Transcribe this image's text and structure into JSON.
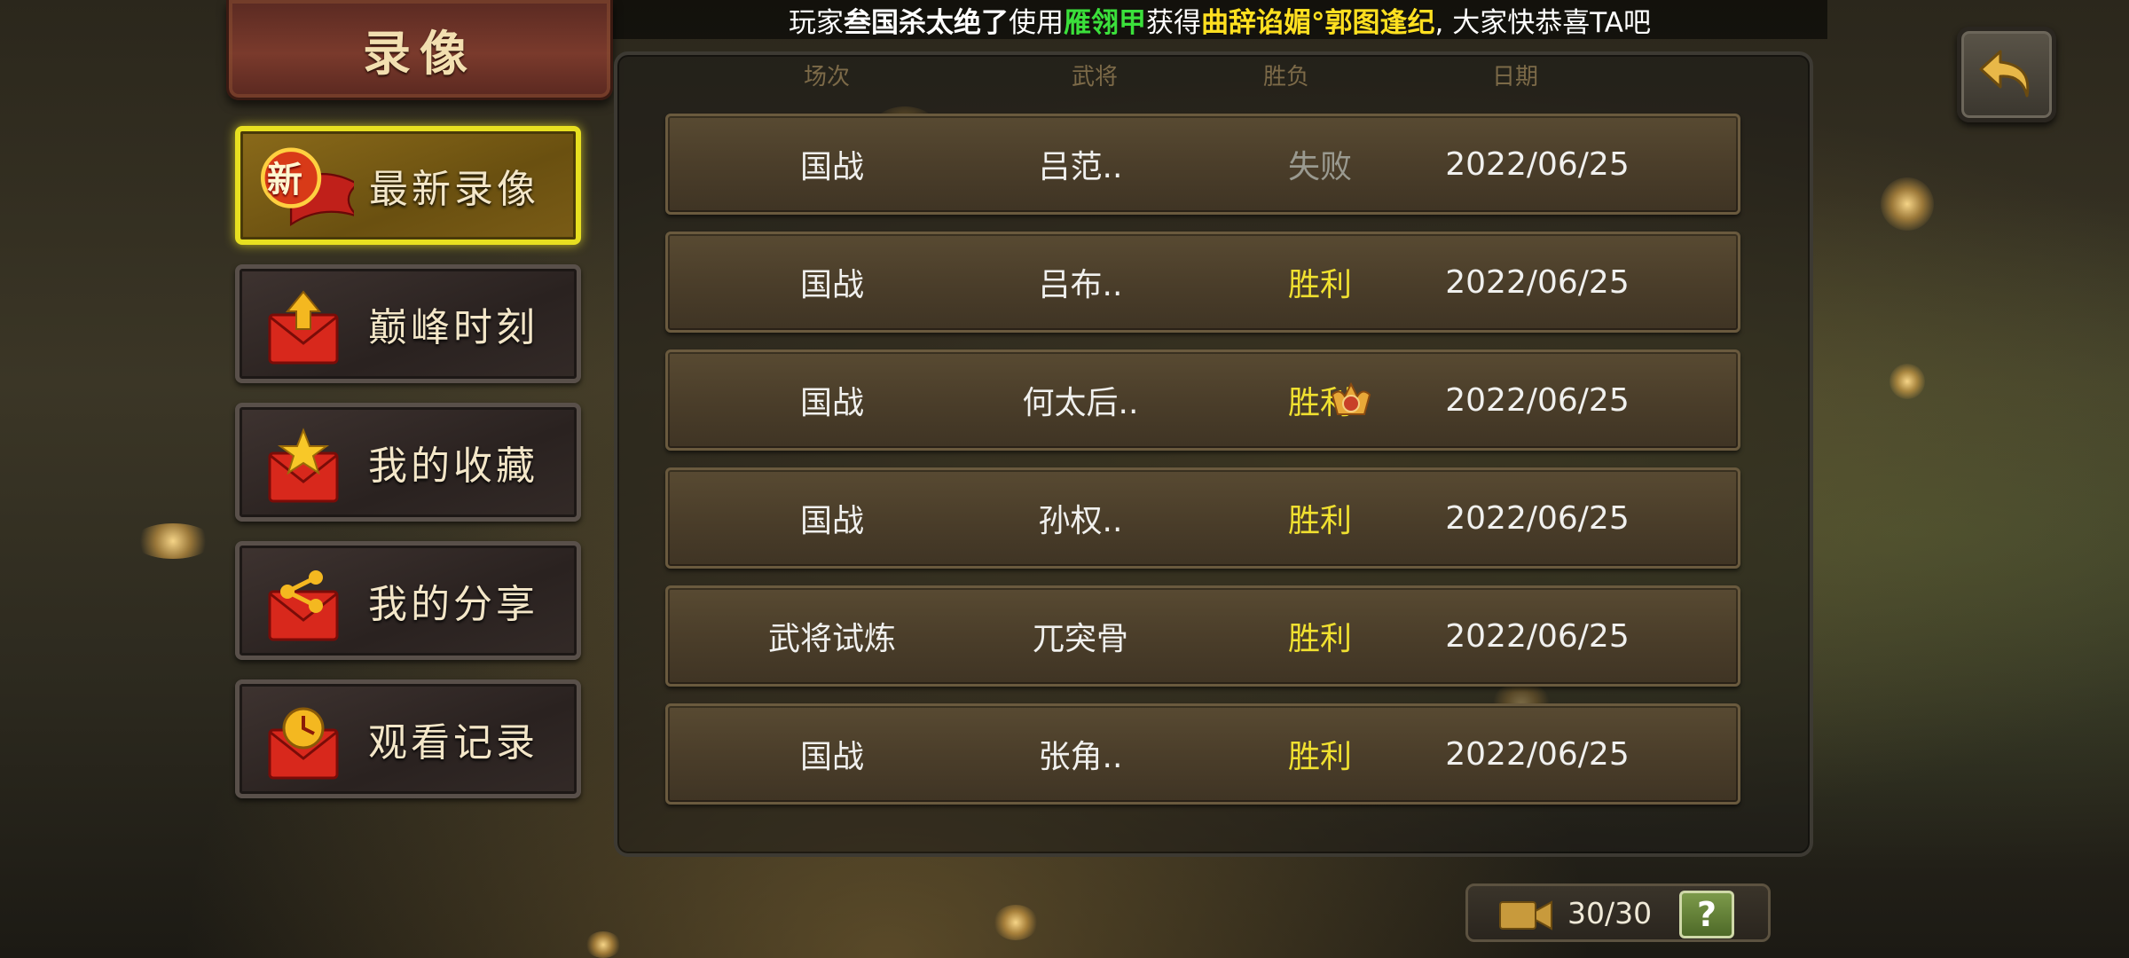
{
  "marquee": {
    "prefix": "玩家",
    "player": "叁国杀太绝了",
    "used": "使用",
    "item": "雁翎甲",
    "got": "获得",
    "prize": "曲辞谄媚°郭图逢纪",
    "suffix": ", 大家快恭喜TA吧"
  },
  "title": "录像",
  "menu": [
    {
      "label": "最新录像",
      "badge": "新",
      "icon": "new-ribbon-icon",
      "active": true
    },
    {
      "label": "巅峰时刻",
      "icon": "arrow-envelope-icon",
      "active": false
    },
    {
      "label": "我的收藏",
      "icon": "star-envelope-icon",
      "active": false
    },
    {
      "label": "我的分享",
      "icon": "share-envelope-icon",
      "active": false
    },
    {
      "label": "观看记录",
      "icon": "history-envelope-icon",
      "active": false
    }
  ],
  "headers": {
    "mode": "场次",
    "general": "武将",
    "result": "胜负",
    "date": "日期"
  },
  "records": [
    {
      "mode": "国战",
      "general": "吕范..",
      "result": "失败",
      "win": false,
      "date": "2022/06/25"
    },
    {
      "mode": "国战",
      "general": "吕布..",
      "result": "胜利",
      "win": true,
      "date": "2022/06/25"
    },
    {
      "mode": "国战",
      "general": "何太后..",
      "result": "胜利",
      "win": true,
      "mvp": true,
      "date": "2022/06/25"
    },
    {
      "mode": "国战",
      "general": "孙权..",
      "result": "胜利",
      "win": true,
      "date": "2022/06/25"
    },
    {
      "mode": "武将试炼",
      "general": "兀突骨",
      "result": "胜利",
      "win": true,
      "date": "2022/06/25"
    },
    {
      "mode": "国战",
      "general": "张角..",
      "result": "胜利",
      "win": true,
      "date": "2022/06/25"
    }
  ],
  "counter": {
    "value": "30/30",
    "help": "?"
  },
  "colors": {
    "win": "#f0e030",
    "lose": "#9a9a90",
    "active_border": "#e8e020"
  }
}
